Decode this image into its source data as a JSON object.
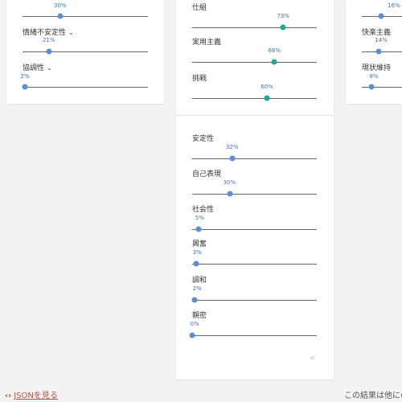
{
  "colors": {
    "blue": "#5b8fd9",
    "teal": "#1fa896",
    "value": "#3b73b9"
  },
  "left_panel": {
    "sliders": [
      {
        "label": "",
        "value": 30,
        "value_text": "30%"
      },
      {
        "label": "情緒不安定性",
        "value": 21,
        "value_text": "21%",
        "has_chevron": true
      },
      {
        "label": "協調性",
        "value": 2,
        "value_text": "2%",
        "has_chevron": true
      }
    ]
  },
  "middle_top_panel": {
    "sliders": [
      {
        "label": "仕組",
        "value": 73,
        "value_text": "73%"
      },
      {
        "label": "実用主義",
        "value": 66,
        "value_text": "66%"
      },
      {
        "label": "挑戦",
        "value": 60,
        "value_text": "60%"
      }
    ]
  },
  "middle_bottom_panel": {
    "sliders": [
      {
        "label": "安定性",
        "value": 32,
        "value_text": "32%"
      },
      {
        "label": "自己表現",
        "value": 30,
        "value_text": "30%"
      },
      {
        "label": "社会性",
        "value": 5,
        "value_text": "5%"
      },
      {
        "label": "興奮",
        "value": 3,
        "value_text": "3%"
      },
      {
        "label": "調和",
        "value": 2,
        "value_text": "2%"
      },
      {
        "label": "親密",
        "value": 0,
        "value_text": "0%"
      }
    ],
    "collapse_glyph": "‹‹"
  },
  "right_panel": {
    "sliders": [
      {
        "label": "",
        "value_text": "16%"
      },
      {
        "label": "快楽主義",
        "value_text": "14%"
      },
      {
        "label": "現状維持",
        "value_text": "8%"
      }
    ]
  },
  "footer": {
    "json_link_icon": "‹›",
    "json_link_text": "JSONを見る",
    "note": "この結果は他にの"
  },
  "icons": {
    "chevron": "chevron-down-icon",
    "collapse": "double-chevron-left-icon",
    "code": "code-icon"
  }
}
